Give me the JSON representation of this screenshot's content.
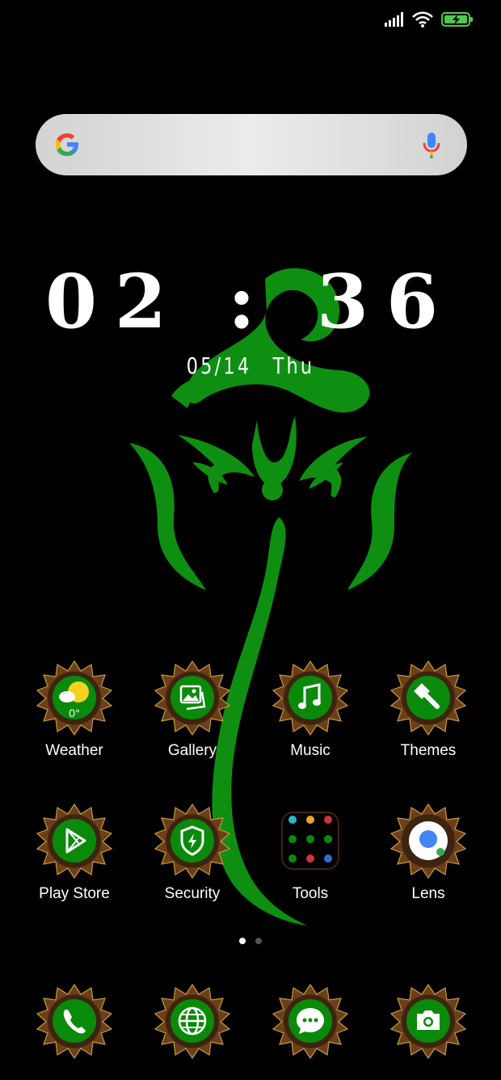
{
  "status_bar": {
    "signal_icon": "signal-icon",
    "wifi_icon": "wifi-icon",
    "battery_icon": "battery-charging-icon"
  },
  "search_bar": {
    "logo_icon": "google-g-icon",
    "mic_icon": "mic-icon"
  },
  "clock": {
    "time": "02 : 36",
    "date": "05/14",
    "weekday": "Thu"
  },
  "apps": [
    {
      "label": "Weather",
      "icon": "weather-icon",
      "temp": "0°"
    },
    {
      "label": "Gallery",
      "icon": "gallery-icon"
    },
    {
      "label": "Music",
      "icon": "music-note-icon"
    },
    {
      "label": "Themes",
      "icon": "paintbrush-icon"
    },
    {
      "label": "Play Store",
      "icon": "play-store-icon"
    },
    {
      "label": "Security",
      "icon": "shield-bolt-icon"
    },
    {
      "label": "Tools",
      "icon": "tools-folder-icon"
    },
    {
      "label": "Lens",
      "icon": "lens-icon"
    }
  ],
  "dock": [
    {
      "icon": "phone-icon"
    },
    {
      "icon": "globe-icon"
    },
    {
      "icon": "message-icon"
    },
    {
      "icon": "camera-icon"
    }
  ],
  "page_indicator": {
    "pages": 2,
    "active": 1
  },
  "colors": {
    "accent_green": "#0a8a0a",
    "frame_brown": "#6b3f1a",
    "wallpaper_green": "#0f8f12"
  }
}
